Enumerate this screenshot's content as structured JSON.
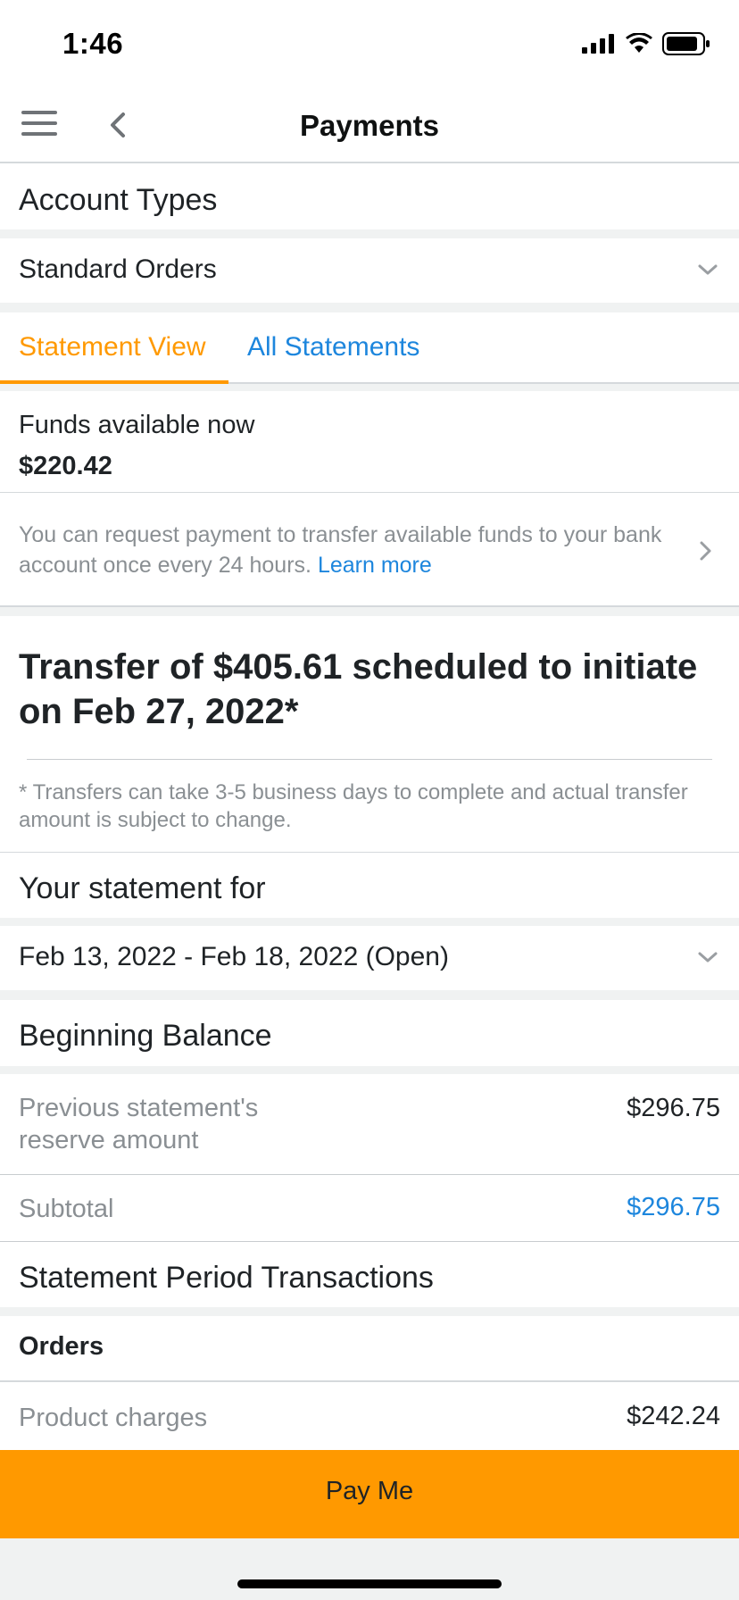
{
  "status_bar": {
    "time": "1:46"
  },
  "nav": {
    "title": "Payments"
  },
  "account_types": {
    "heading": "Account Types",
    "selected": "Standard Orders"
  },
  "tabs": [
    {
      "label": "Statement View",
      "active": true
    },
    {
      "label": "All Statements",
      "active": false
    }
  ],
  "funds": {
    "label": "Funds available now",
    "amount": "$220.42"
  },
  "info": {
    "text": "You can request payment to transfer available funds to your bank account once every 24 hours.",
    "link": "Learn more"
  },
  "transfer": {
    "heading": "Transfer of $405.61 scheduled to initiate on Feb 27, 2022*",
    "note": "* Transfers can take 3-5 business days to complete and actual transfer amount is subject to change."
  },
  "statement": {
    "heading": "Your statement for",
    "period": "Feb 13, 2022 - Feb 18, 2022 (Open)"
  },
  "beginning_balance": {
    "heading": "Beginning Balance",
    "rows": [
      {
        "label": "Previous statement's reserve amount",
        "value": "$296.75"
      },
      {
        "label": "Subtotal",
        "value": "$296.75"
      }
    ]
  },
  "transactions": {
    "heading": "Statement Period Transactions",
    "group": "Orders",
    "rows": [
      {
        "label": "Product charges",
        "value": "$242.24"
      }
    ]
  },
  "action": {
    "pay_label": "Pay Me"
  },
  "colors": {
    "accent": "#ff9900",
    "link": "#1d86dd",
    "muted_text": "#8a8f93",
    "band": "#f0f2f2"
  }
}
